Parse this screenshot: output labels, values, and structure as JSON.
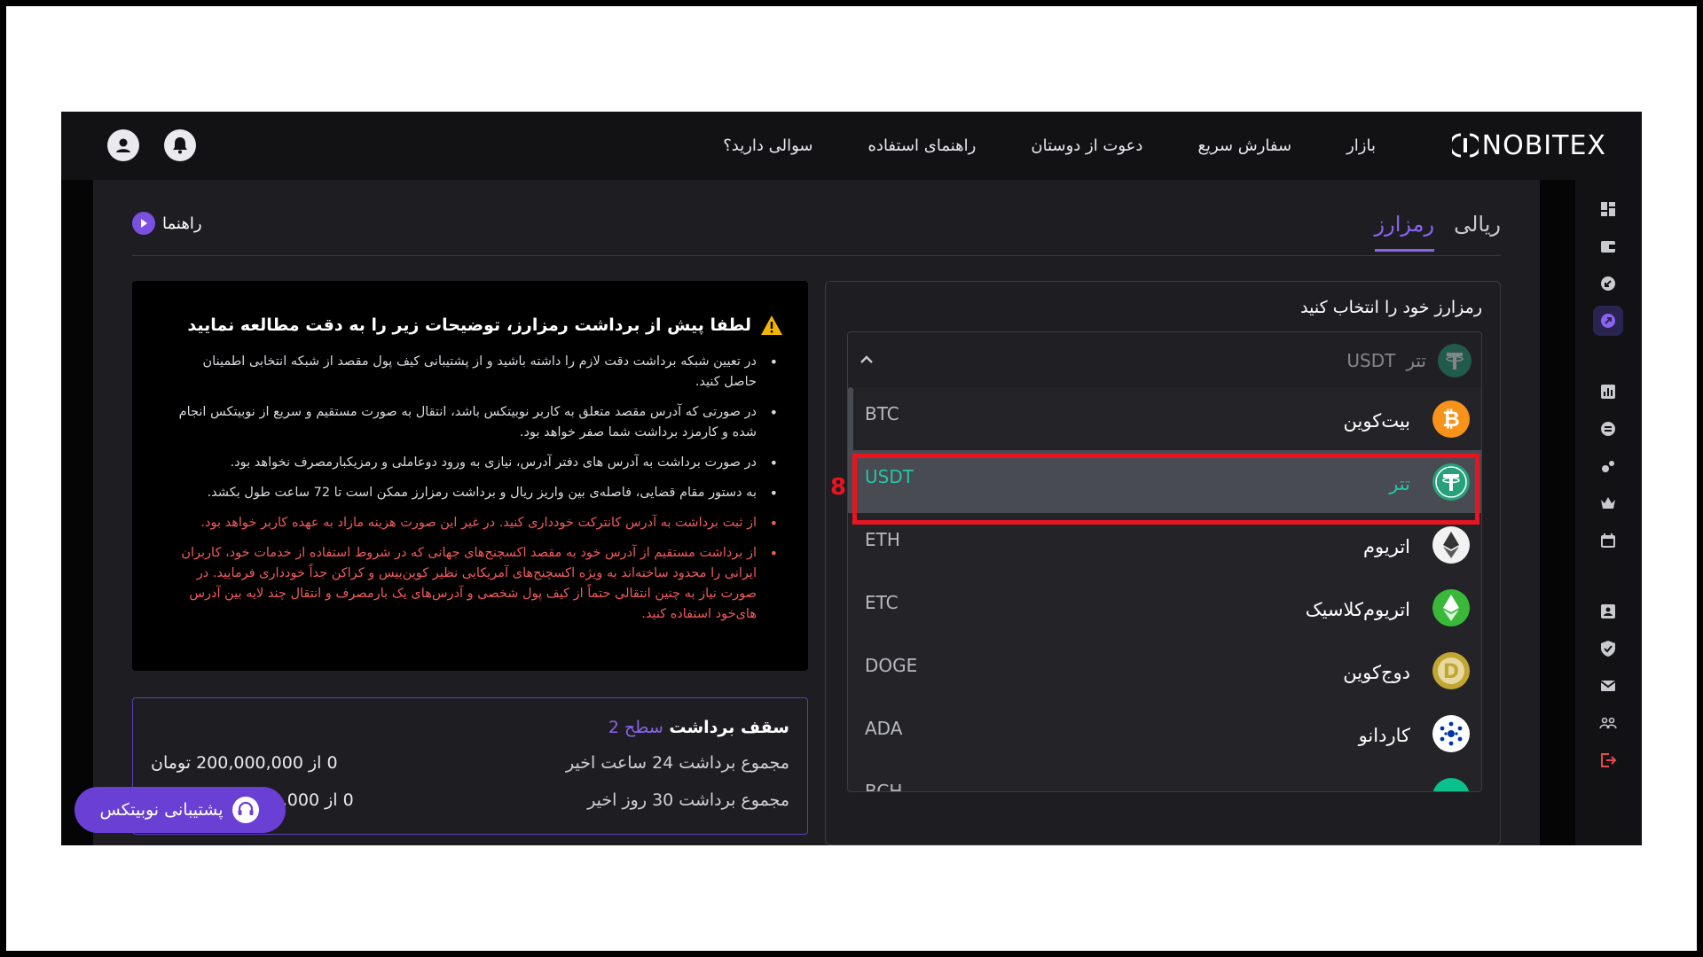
{
  "header": {
    "logo_text": "NOBITEX",
    "nav": [
      "بازار",
      "سفارش سریع",
      "دعوت از دوستان",
      "راهنمای استفاده",
      "سوالی دارید؟"
    ]
  },
  "tabs": {
    "rial": "ریالی",
    "crypto": "رمزارز"
  },
  "guide_label": "راهنما",
  "select": {
    "title": "رمزارز خود را انتخاب کنید",
    "selected": {
      "fa": "تتر",
      "symbol": "USDT",
      "icon": "tether-icon"
    },
    "options": [
      {
        "fa": "بیت‌کوین",
        "symbol": "BTC",
        "icon": "bitcoin-icon",
        "color": "#f7931a"
      },
      {
        "fa": "تتر",
        "symbol": "USDT",
        "icon": "tether-icon",
        "color": "#26a17b"
      },
      {
        "fa": "اتریوم",
        "symbol": "ETH",
        "icon": "ethereum-icon",
        "color": "#ffffff"
      },
      {
        "fa": "اتریوم‌کلاسیک",
        "symbol": "ETC",
        "icon": "ethereum-classic-icon",
        "color": "#3ab83a"
      },
      {
        "fa": "دوج‌کوین",
        "symbol": "DOGE",
        "icon": "dogecoin-icon",
        "color": "#c2a633"
      },
      {
        "fa": "کاردانو",
        "symbol": "ADA",
        "icon": "cardano-icon",
        "color": "#0033ad"
      },
      {
        "fa": "",
        "symbol": "BCH",
        "icon": "bitcoin-cash-icon",
        "color": "#0ac18e"
      }
    ]
  },
  "annotation": {
    "step": "8"
  },
  "notice": {
    "title": "لطفا پیش از برداشت رمزارز، توضیحات زیر را به دقت مطالعه نمایید",
    "items": [
      "در تعیین شبکه برداشت دقت لازم را داشته باشید و از پشتیبانی کیف پول مقصد از شبکه انتخابی اطمینان حاصل کنید.",
      "در صورتی که آدرس مقصد متعلق به کاربر نوبیتکس باشد، انتقال به صورت مستقیم و سریع از نوبیتکس انجام شده و کارمزد برداشت شما صفر خواهد بود.",
      "در صورت برداشت به آدرس های دفتر آدرس، نیازی به ورود دوعاملی و رمزیکبارمصرف نخواهد بود.",
      "به دستور مقام قضایی، فاصله‌ی بین واریز ریال و برداشت رمزارز ممکن است تا 72 ساعت طول بکشد."
    ],
    "warnings": [
      "از ثبت برداشت به آدرس کانترکت خودداری کنید. در غیر این صورت هزینه مازاد به عهده کاربر خواهد بود.",
      "از برداشت مستقیم از آدرس خود به مقصد اکسچنج‌های جهانی که در شروط استفاده از خدمات خود، کاربران ایرانی را محدود ساخته‌اند به ویژه اکسچنج‌های آمریکایی نظیر کوین‌بیس و کراکن جداً خودداری فرمایید. در صورت نیاز به چنین انتقالی حتماً از کیف پول شخصی و آدرس‌های یک بارمصرف و انتقال چند لایه بین آدرس های‌خود استفاده کنید."
    ]
  },
  "limits": {
    "title": "سقف برداشت",
    "level": "سطح 2",
    "daily_label": "مجموع برداشت 24 ساعت اخیر",
    "daily_value": "0 از 200,000,000 تومان",
    "monthly_label": "مجموع برداشت 30 روز اخیر",
    "monthly_value": "0 از 1,500,000,000 تومان"
  },
  "support_label": "پشتیبانی نوبیتکس",
  "colors": {
    "accent": "#8a63f0",
    "tether": "#26a17b",
    "highlight_text": "#22c7a5",
    "annotation": "#e8141f"
  }
}
